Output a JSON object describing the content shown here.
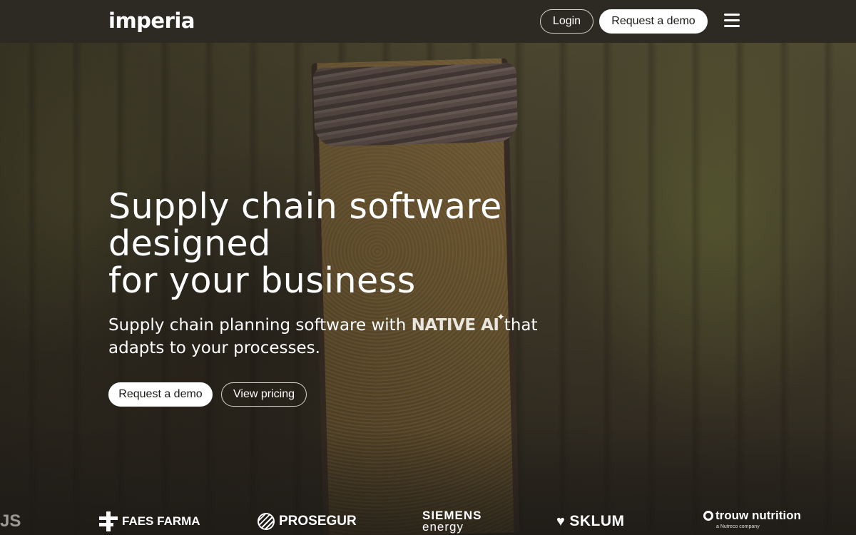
{
  "navbar": {
    "logo_text": "imperia",
    "login_label": "Login",
    "demo_label": "Request a demo",
    "menu_icon": "hamburger-menu-icon"
  },
  "hero": {
    "title_line1": "Supply chain software designed",
    "title_line2": "for your business",
    "subtitle_before": "Supply chain planning software with ",
    "subtitle_highlight": "NATIVE AI",
    "subtitle_after": " that adapts to your processes.",
    "sparkle_icon": "sparkle-icon",
    "cta_demo_label": "Request a demo",
    "cta_pricing_label": "View pricing"
  },
  "clients": {
    "partial_logo": "JS",
    "faes_farma": "FAES FARMA",
    "prosegur": "PROSEGUR",
    "siemens_line1": "SIEMENS",
    "siemens_line2": "energy",
    "sklum": "SKLUM",
    "trouw_line1": "trouw nutrition",
    "trouw_line2": "a Nutreco company"
  },
  "colors": {
    "navbar_bg": "#2d2923",
    "button_outline": "#d9d6d0",
    "button_solid_bg": "#ffffff",
    "text": "#ffffff"
  }
}
